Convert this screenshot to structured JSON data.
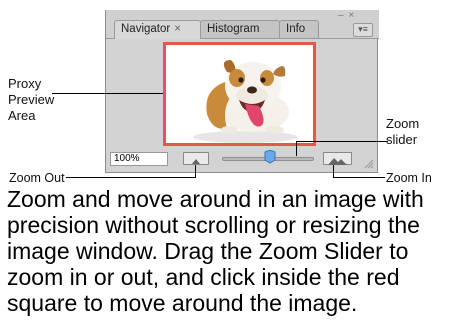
{
  "navigator_panel": {
    "tabs": [
      {
        "label": "Navigator",
        "close_glyph": "×",
        "active": true
      },
      {
        "label": "Histogram",
        "active": false
      },
      {
        "label": "Info",
        "active": false
      }
    ],
    "window_controls": "– ×",
    "panel_menu_glyph": "▾≡",
    "zoom_value": "100%",
    "zoom_slider_level": 0.52,
    "proxy_frame_color": "#e8544e",
    "panel_bg_color": "#d3d3d3"
  },
  "callouts": {
    "proxy_preview": "Proxy\nPreview\nArea",
    "zoom_slider": "Zoom\nslider",
    "zoom_out": "Zoom Out",
    "zoom_in": "Zoom In"
  },
  "description": "Zoom and move around in an image with precision without scrolling or resizing the image window. Drag the Zoom Slider to zoom in or out, and click inside the red square to move around the image."
}
